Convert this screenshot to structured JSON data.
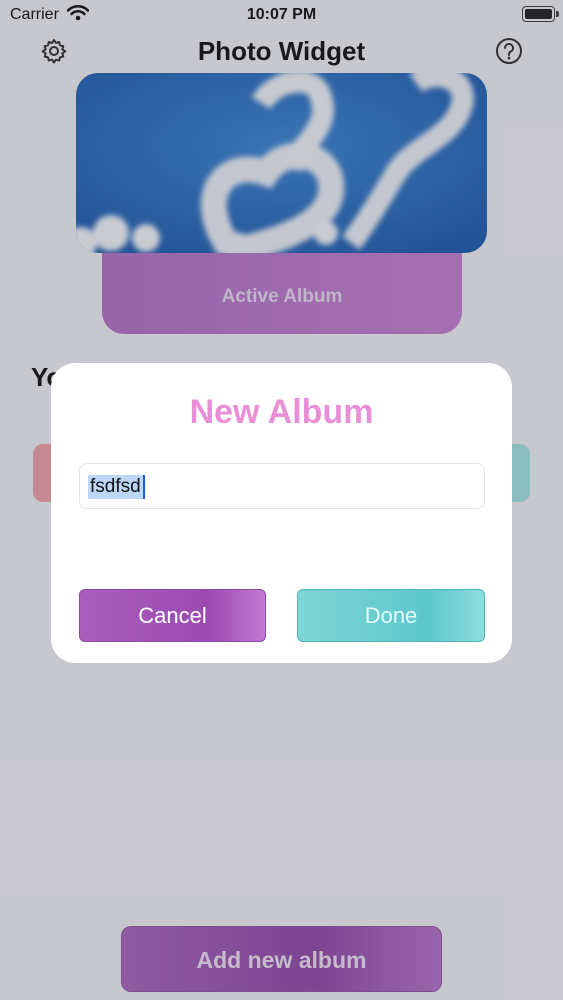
{
  "status_bar": {
    "carrier": "Carrier",
    "time": "10:07 PM"
  },
  "header": {
    "title": "Photo Widget",
    "settings_icon": "gear-icon",
    "help_icon": "question-circle-icon"
  },
  "active_album": {
    "label": "Active Album"
  },
  "albums_section": {
    "title": "Yo"
  },
  "dialog": {
    "title": "New Album",
    "input_value": "fsdfsd",
    "cancel_label": "Cancel",
    "done_label": "Done"
  },
  "footer": {
    "add_album_label": "Add new album"
  },
  "colors": {
    "accent_purple": "#a95fbd",
    "accent_teal": "#5cc8cc",
    "dialog_title_pink": "#e88fd8"
  }
}
